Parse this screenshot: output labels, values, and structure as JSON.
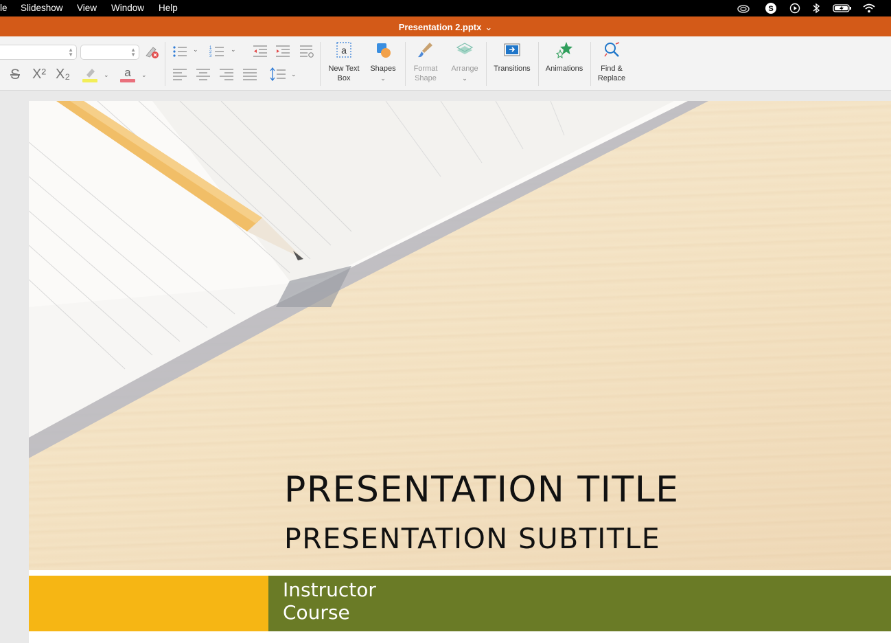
{
  "menubar": {
    "items": [
      "le",
      "Slideshow",
      "View",
      "Window",
      "Help"
    ],
    "status_icons": [
      "creative-cloud-icon",
      "skype-icon",
      "play-icon",
      "bluetooth-icon",
      "battery-icon",
      "wifi-icon"
    ]
  },
  "window": {
    "title": "Presentation 2.pptx",
    "title_chevron": "⌄",
    "accent": "#d35a18"
  },
  "ribbon": {
    "font_name_value": "",
    "font_size_value": "",
    "superscript": "X²",
    "subscript": "X₂",
    "strikethrough": "S",
    "font_color_letter": "a",
    "buttons": {
      "new_text_box": "New Text Box",
      "shapes": "Shapes",
      "format_shape": "Format Shape",
      "arrange": "Arrange",
      "transitions": "Transitions",
      "animations": "Animations",
      "find_replace": "Find & Replace"
    }
  },
  "slide": {
    "title": "PRESENTATION TITLE",
    "subtitle": "PRESENTATION SUBTITLE",
    "footer_line1": "Instructor",
    "footer_line2": "Course",
    "colors": {
      "footer_left": "#f6b614",
      "footer_right": "#6a7b26"
    }
  }
}
